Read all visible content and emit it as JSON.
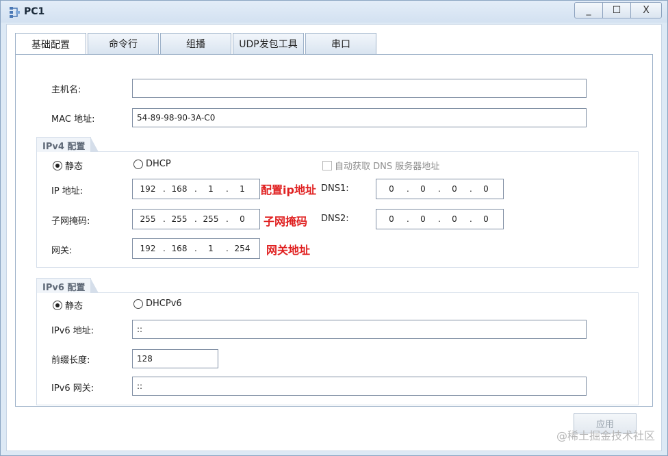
{
  "window": {
    "title": "PC1",
    "controls": {
      "minimize": "_",
      "maximize": "☐",
      "close": "X"
    }
  },
  "tabs": [
    "基础配置",
    "命令行",
    "组播",
    "UDP发包工具",
    "串口"
  ],
  "basic": {
    "hostname_label": "主机名:",
    "hostname_value": "",
    "mac_label": "MAC 地址:",
    "mac_value": "54-89-98-90-3A-C0"
  },
  "ipv4": {
    "section_title": "IPv4 配置",
    "static_label": "静态",
    "dhcp_label": "DHCP",
    "auto_dns_label": "自动获取 DNS 服务器地址",
    "ip_label": "IP 地址:",
    "ip": [
      "192",
      "168",
      "1",
      "1"
    ],
    "mask_label": "子网掩码:",
    "mask": [
      "255",
      "255",
      "255",
      "0"
    ],
    "gateway_label": "网关:",
    "gateway": [
      "192",
      "168",
      "1",
      "254"
    ],
    "dns1_label": "DNS1:",
    "dns1": [
      "0",
      "0",
      "0",
      "0"
    ],
    "dns2_label": "DNS2:",
    "dns2": [
      "0",
      "0",
      "0",
      "0"
    ]
  },
  "annotations": {
    "ip": "配置ip地址",
    "mask": "子网掩码",
    "gateway": "网关地址"
  },
  "ipv6": {
    "section_title": "IPv6 配置",
    "static_label": "静态",
    "dhcp_label": "DHCPv6",
    "address_label": "IPv6 地址:",
    "address_value": "::",
    "prefix_label": "前缀长度:",
    "prefix_value": "128",
    "gateway_label": "IPv6 网关:",
    "gateway_value": "::"
  },
  "apply_label": "应用",
  "watermark": "@稀土掘金技术社区"
}
